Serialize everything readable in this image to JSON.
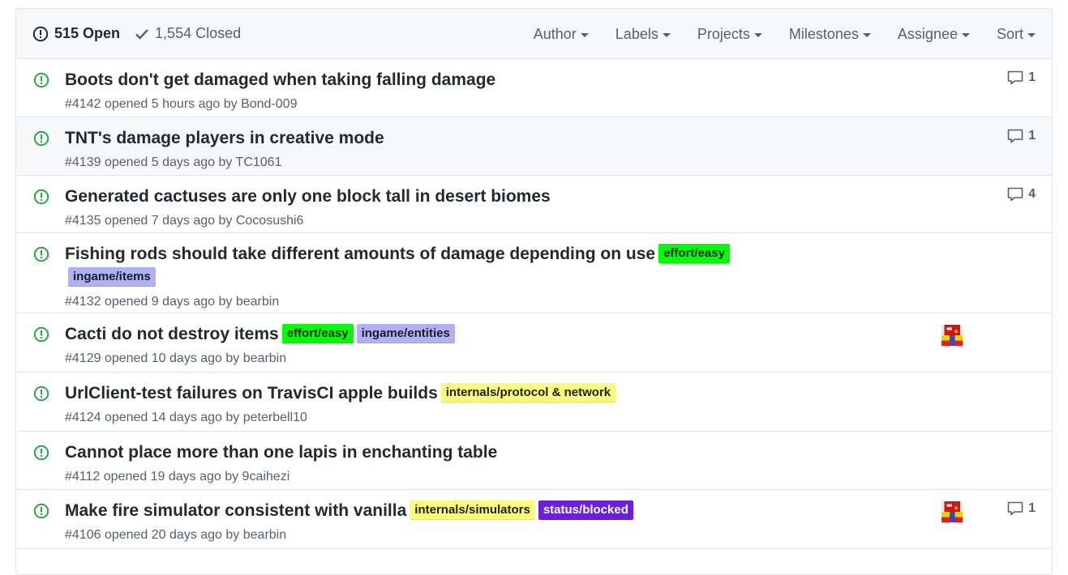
{
  "states": {
    "open_label": "515 Open",
    "closed_label": "1,554 Closed"
  },
  "filters": [
    "Author",
    "Labels",
    "Projects",
    "Milestones",
    "Assignee",
    "Sort"
  ],
  "issues": [
    {
      "title": "Boots don't get damaged when taking falling damage",
      "meta": "#4142 opened 5 hours ago by Bond-009",
      "labels": [],
      "comments": "1",
      "avatar": false
    },
    {
      "title": "TNT's damage players in creative mode",
      "meta": "#4139 opened 5 days ago by TC1061",
      "labels": [],
      "comments": "1",
      "avatar": false
    },
    {
      "title": "Generated cactuses are only one block tall in desert biomes",
      "meta": "#4135 opened 7 days ago by Cocosushi6",
      "labels": [],
      "comments": "4",
      "avatar": false
    },
    {
      "title": "Fishing rods should take different amounts of damage depending on use",
      "meta": "#4132 opened 9 days ago by bearbin",
      "labels": [
        {
          "text": "effort/easy",
          "bg": "#00ff00",
          "fg": "#1b1f23"
        },
        {
          "text": "ingame/items",
          "bg": "#b2b0f5",
          "fg": "#1b1f23"
        }
      ],
      "comments": "",
      "avatar": false
    },
    {
      "title": "Cacti do not destroy items",
      "meta": "#4129 opened 10 days ago by bearbin",
      "labels": [
        {
          "text": "effort/easy",
          "bg": "#00ff00",
          "fg": "#1b1f23"
        },
        {
          "text": "ingame/entities",
          "bg": "#b2b0f5",
          "fg": "#1b1f23"
        }
      ],
      "comments": "",
      "avatar": true
    },
    {
      "title": "UrlClient-test failures on TravisCI apple builds",
      "meta": "#4124 opened 14 days ago by peterbell10",
      "labels": [
        {
          "text": "internals/protocol & network",
          "bg": "#fbfb7a",
          "fg": "#1b1f23"
        }
      ],
      "comments": "",
      "avatar": false
    },
    {
      "title": "Cannot place more than one lapis in enchanting table",
      "meta": "#4112 opened 19 days ago by 9caihezi",
      "labels": [],
      "comments": "",
      "avatar": false
    },
    {
      "title": "Make fire simulator consistent with vanilla",
      "meta": "#4106 opened 20 days ago by bearbin",
      "labels": [
        {
          "text": "internals/simulators",
          "bg": "#fbfb7a",
          "fg": "#1b1f23"
        },
        {
          "text": "status/blocked",
          "bg": "#6a1fdf",
          "fg": "#ffffff"
        }
      ],
      "comments": "1",
      "avatar": true
    }
  ],
  "colors": {
    "open_icon": "#28a745",
    "muted": "#586069",
    "highlight_row_index": 1
  },
  "icons": {
    "open": "issue-opened-icon",
    "closed": "check-icon",
    "comment": "comment-icon",
    "caret": "caret-down-icon"
  }
}
